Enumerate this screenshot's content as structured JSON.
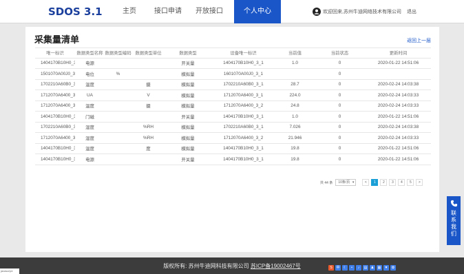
{
  "header": {
    "logo": "SDOS 3.1",
    "nav": [
      {
        "label": "主页",
        "active": false
      },
      {
        "label": "接口申请",
        "active": false
      },
      {
        "label": "开放接口",
        "active": false
      },
      {
        "label": "个人中心",
        "active": true
      }
    ],
    "welcome": "欢迎回来,苏州牛迪网络技术有限公司",
    "logout": "退出"
  },
  "page": {
    "title": "采集量清单",
    "back": "返回上一层"
  },
  "table": {
    "columns": [
      "唯一标识",
      "数据类型名称",
      "数据类型编码",
      "数据类型单位",
      "数据类型",
      "设备唯一标识",
      "当前值",
      "当前状态",
      "更新时间"
    ],
    "rows": [
      [
        "1404170B10H0_3_1_1_1",
        "电源",
        "",
        "",
        "开关量",
        "1404170B10H0_3_1",
        "1.0",
        "0",
        "2020-01-22 14:51:06"
      ],
      [
        "1501070A00J0_3_1_0_1",
        "电位",
        "%",
        "",
        "模拟量",
        "1601070A00J0_3_1",
        "",
        "0",
        ""
      ],
      [
        "1702210A60B0_3_1_0_1",
        "温度",
        "",
        "摄",
        "模拟量",
        "1702210A60B0_3_1",
        "28.7",
        "0",
        "2020-02-24 14:03:38"
      ],
      [
        "1712070A6400_3_1_0_1",
        "UA",
        "",
        "V",
        "模拟量",
        "1712070A6400_3_1",
        "224.0",
        "0",
        "2020-02-24 14:03:33"
      ],
      [
        "1712070A6400_3_2_0_1",
        "温度",
        "",
        "摄",
        "模拟量",
        "1712070A6400_3_2",
        "24.8",
        "0",
        "2020-02-24 14:03:33"
      ],
      [
        "1404170B10H0_3_1_1_2",
        "门磁",
        "",
        "",
        "开关量",
        "1404170B10H0_3_1",
        "1.0",
        "0",
        "2020-01-22 14:51:06"
      ],
      [
        "1702210A60B0_3_1_0_2",
        "湿度",
        "",
        "%RH",
        "模拟量",
        "1702210A60B0_3_1",
        "7.026",
        "0",
        "2020-02-24 14:03:38"
      ],
      [
        "1712070A6400_3_2_0_2",
        "湿度",
        "",
        "%RH",
        "模拟量",
        "1712070A6400_3_2",
        "21.946",
        "0",
        "2020-02-24 14:03:33"
      ],
      [
        "1404170B10H0_3_1_0_3",
        "温度",
        "",
        "度",
        "模拟量",
        "1404170B10H0_3_1",
        "19.8",
        "0",
        "2020-01-22 14:51:06"
      ],
      [
        "1404170B10H0_3_1_1_3",
        "电源",
        "",
        "",
        "开关量",
        "1404170B10H0_3_1",
        "19.8",
        "0",
        "2020-01-22 14:51:06"
      ]
    ]
  },
  "pagination": {
    "total": "共 44 条",
    "page_size": "10条/页",
    "prev": "<",
    "pages": [
      "1",
      "2",
      "3",
      "4",
      "5"
    ],
    "current": "1",
    "next": ">"
  },
  "footer": {
    "copyright": "版权所有: 苏州牛迪网科技有限公司",
    "icp": "苏ICP备19002467号",
    "badge": "javascript:"
  },
  "contact": {
    "label": "联系我们",
    "color": "#1a56c8"
  },
  "colors": {
    "brand": "#1a56c8",
    "page_active": "#1a9fd6",
    "footer_bg": "#3c3c3c"
  }
}
